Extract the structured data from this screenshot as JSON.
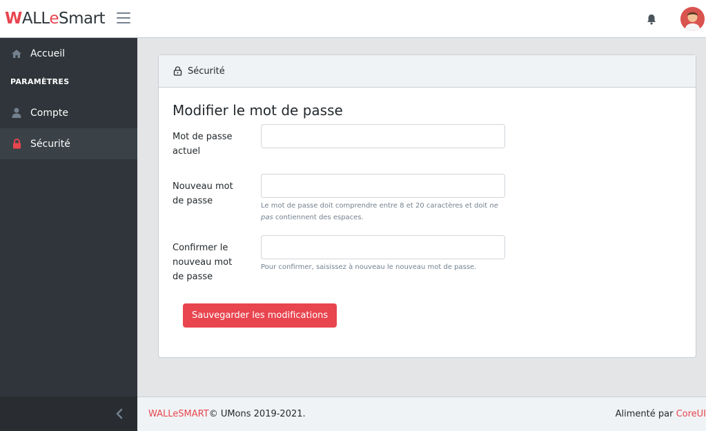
{
  "brand": {
    "w": "W",
    "pre": "ALL",
    "e": "e",
    "post": "Smart"
  },
  "sidebar": {
    "home": "Accueil",
    "section_title": "PARAMÈTRES",
    "account": "Compte",
    "security": "Sécurité"
  },
  "card": {
    "header": "Sécurité",
    "title": "Modifier le mot de passe",
    "current_password_label_1": "Mot de passe",
    "current_password_label_2": "actuel",
    "new_password_label_1": "Nouveau mot",
    "new_password_label_2": "de passe",
    "new_password_help_1": "Le mot de passe doit comprendre entre 8 et 20 caractères et doit",
    "new_password_help_em": "ne pas",
    "new_password_help_2": "contiennent des espaces.",
    "confirm_label_1": "Confirmer le",
    "confirm_label_2": "nouveau mot",
    "confirm_label_3": "de passe",
    "confirm_help": "Pour confirmer, saisissez à nouveau le nouveau mot de passe.",
    "save_button": "Sauvegarder les modifications"
  },
  "footer": {
    "brand": "WALLeSMART",
    "copyright": "© UMons 2019-2021.",
    "powered_by": "Alimenté par",
    "coreui": "CoreUI"
  },
  "colors": {
    "accent": "#e8454f",
    "sidebar": "#2f353a",
    "background": "#e4e5e6"
  },
  "icons": [
    "hamburger-icon",
    "bell-icon",
    "home-icon",
    "user-icon",
    "lock-icon",
    "chevron-left-icon"
  ]
}
